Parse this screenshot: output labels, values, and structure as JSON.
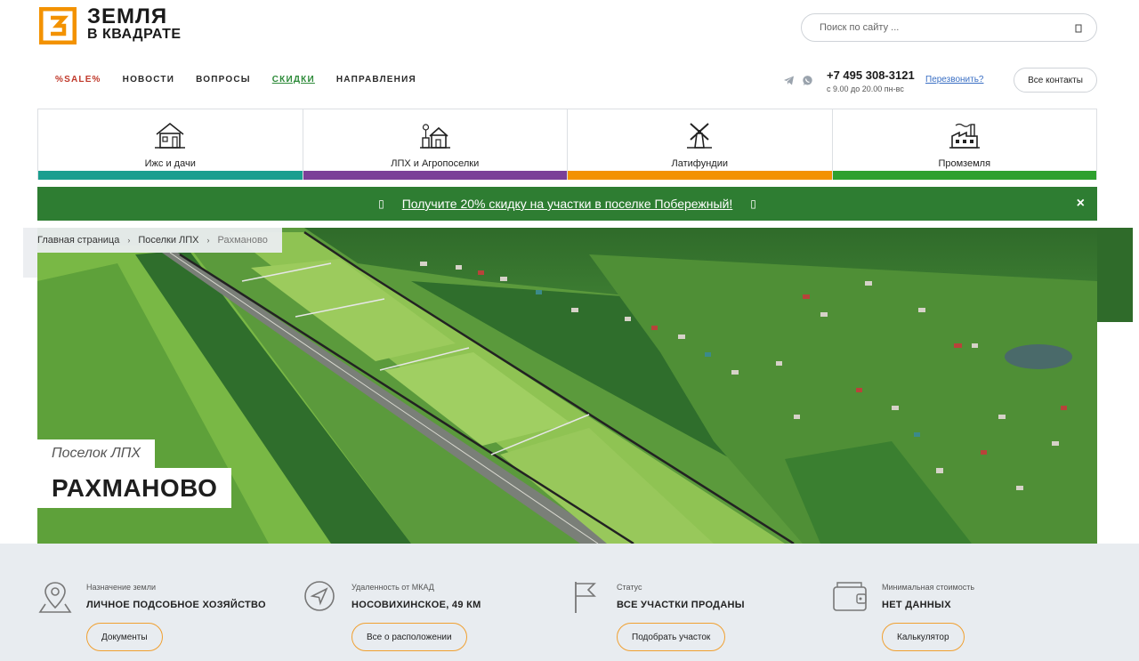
{
  "header": {
    "logo_line1": "ЗЕМЛЯ",
    "logo_line2": "В КВАДРАТЕ",
    "search_placeholder": "Поиск по сайту ...",
    "nav": [
      {
        "label": "%SALE%",
        "kind": "sale"
      },
      {
        "label": "НОВОСТИ",
        "kind": "normal"
      },
      {
        "label": "ВОПРОСЫ",
        "kind": "normal"
      },
      {
        "label": "СКИДКИ",
        "kind": "active"
      },
      {
        "label": "НАПРАВЛЕНИЯ",
        "kind": "normal"
      }
    ],
    "messengers": [
      "telegram-icon",
      "whatsapp-icon"
    ],
    "phone": "+7 495 308-3121",
    "hours": "с 9.00 до 20.00 пн-вс",
    "callback": "Перезвонить?",
    "contacts_button": "Все контакты"
  },
  "categories": [
    {
      "label": "Ижс и дачи",
      "icon": "house-icon",
      "color": "#1a9e8f"
    },
    {
      "label": "ЛПХ и Агропоселки",
      "icon": "farm-house-icon",
      "color": "#7b3f98"
    },
    {
      "label": "Латифундии",
      "icon": "windmill-icon",
      "color": "#f39200"
    },
    {
      "label": "Промземля",
      "icon": "factory-icon",
      "color": "#2ea02e"
    }
  ],
  "promo": {
    "text": "Получите 20% скидку на участки в поселке Побережный!",
    "close": "×"
  },
  "breadcrumb": [
    "Главная страница",
    "Поселки ЛПХ",
    "Рахманово"
  ],
  "hero": {
    "subtitle": "Поселок ЛПХ",
    "title": "РАХМАНОВО"
  },
  "info": [
    {
      "label": "Назначение земли",
      "value": "ЛИЧНОЕ ПОДСОБНОЕ ХОЗЯЙСТВО",
      "button": "Документы",
      "icon": "map-pin-icon"
    },
    {
      "label": "Удаленность от МКАД",
      "value": "НОСОВИХИНСКОЕ, 49 КМ",
      "button": "Все о расположении",
      "icon": "navigation-arrow-icon"
    },
    {
      "label": "Статус",
      "value": "ВСЕ УЧАСТКИ ПРОДАНЫ",
      "button": "Подобрать участок",
      "icon": "flag-icon"
    },
    {
      "label": "Минимальная стоимость",
      "value": "НЕТ ДАННЫХ",
      "button": "Калькулятор",
      "icon": "wallet-icon"
    }
  ],
  "colors": {
    "promo_bg": "#2e7d32",
    "accent_orange": "#f0a030",
    "info_bg": "#e8ecf0"
  }
}
